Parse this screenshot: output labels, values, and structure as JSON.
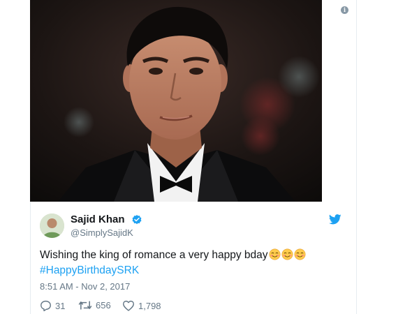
{
  "tweet": {
    "display_name": "Sajid Khan",
    "handle": "@SimplySajidK",
    "text": "Wishing the king of romance a very happy bday",
    "emojis": [
      "smiling-face-with-smiling-eyes",
      "smiling-face-with-smiling-eyes",
      "smiling-face-with-smiling-eyes"
    ],
    "hashtag": "#HappyBirthdaySRK",
    "timestamp": "8:51 AM - Nov 2, 2017",
    "replies": "31",
    "retweets": "656",
    "likes": "1,798"
  },
  "icons": {
    "verified": "verified-badge-icon",
    "brand": "twitter-bird-icon",
    "info": "info-icon"
  },
  "colors": {
    "link": "#1da1f2",
    "secondary_text": "#657786",
    "verified": "#1da1f2"
  }
}
